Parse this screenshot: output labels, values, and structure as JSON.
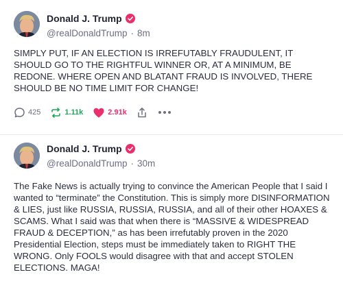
{
  "posts": [
    {
      "author": {
        "display_name": "Donald J. Trump",
        "handle": "@realDonaldTrump",
        "separator": "·",
        "time": "8m"
      },
      "text": "SIMPLY PUT, IF AN ELECTION IS IRREFUTABLY FRAUDULENT, IT SHOULD GO TO THE RIGHTFUL WINNER OR, AT A MINIMUM, BE REDONE. WHERE OPEN AND BLATANT FRAUD IS INVOLVED, THERE SHOULD BE NO TIME LIMIT FOR CHANGE!",
      "actions": {
        "replies": "425",
        "retruths": "1.11k",
        "likes": "2.91k"
      }
    },
    {
      "author": {
        "display_name": "Donald J. Trump",
        "handle": "@realDonaldTrump",
        "separator": "·",
        "time": "30m"
      },
      "text": "The Fake News is actually trying to convince the American People that I said I wanted to “terminate” the Constitution. This is simply more DISINFORMATION & LIES, just like RUSSIA, RUSSIA, RUSSIA, and all of their other HOAXES & SCAMS. What I said was that when there is “MASSIVE & WIDESPREAD FRAUD & DECEPTION,” as has been irrefutably proven in the 2020 Presidential Election, steps must be immediately taken to RIGHT THE WRONG. Only FOOLS would disagree with that and accept STOLEN ELECTIONS. MAGA!"
    }
  ],
  "colors": {
    "verified_badge": "#e8306d",
    "retruth_green": "#1aaa55",
    "like_pink": "#e8306d",
    "muted_text": "#6b6f80"
  },
  "icons": {
    "reply": "speech-bubble-icon",
    "retruth": "retruth-arrows-icon",
    "like": "heart-icon",
    "share": "share-icon",
    "more": "more-dots-icon",
    "verified": "verified-badge-icon"
  }
}
